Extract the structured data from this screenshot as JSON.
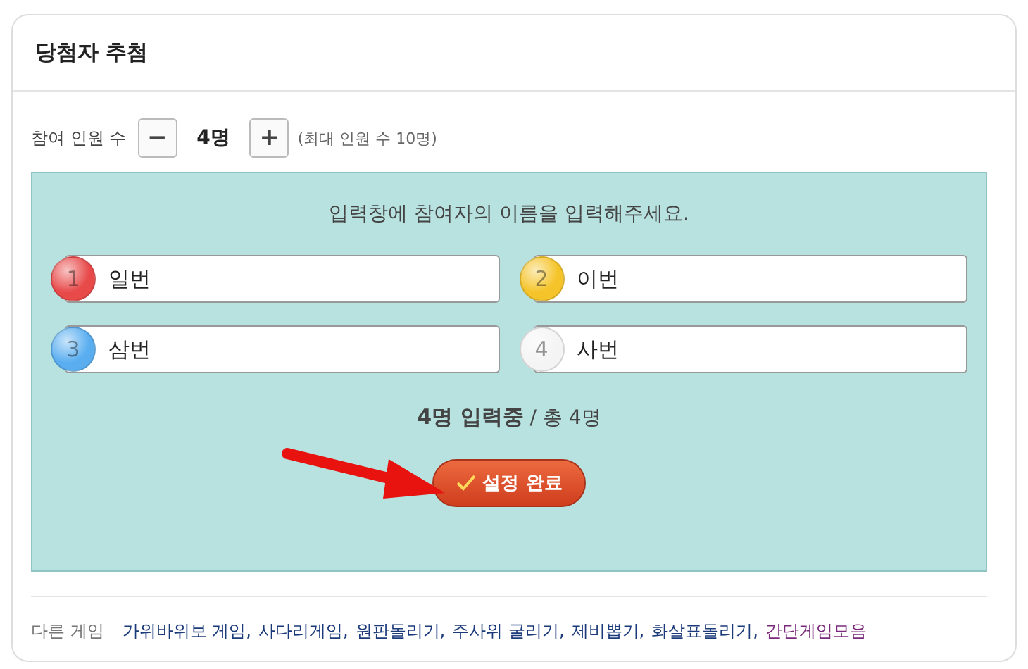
{
  "header": {
    "title": "당첨자 추첨"
  },
  "counter": {
    "label": "참여 인원 수",
    "minus": "−",
    "value": "4명",
    "plus": "+",
    "note": "(최대 인원 수 10명)"
  },
  "panel": {
    "instruction": "입력창에 참여자의 이름을 입력해주세요.",
    "entries": [
      {
        "number": "1",
        "value": "일번",
        "color": "#e84a4a"
      },
      {
        "number": "2",
        "value": "이번",
        "color": "#f5c42a"
      },
      {
        "number": "3",
        "value": "삼번",
        "color": "#5aaef0"
      },
      {
        "number": "4",
        "value": "사번",
        "color": "#f4f4f4"
      }
    ],
    "status_bold": "4명 입력중",
    "status_rest": "/ 총 4명",
    "button": "설정 완료"
  },
  "footer": {
    "label": "다른 게임",
    "links": [
      {
        "text": "가위바위보 게임,",
        "visited": false
      },
      {
        "text": "사다리게임,",
        "visited": false
      },
      {
        "text": "원판돌리기,",
        "visited": false
      },
      {
        "text": "주사위 굴리기,",
        "visited": false
      },
      {
        "text": "제비뽑기,",
        "visited": false
      },
      {
        "text": "화살표돌리기,",
        "visited": false
      },
      {
        "text": "간단게임모음",
        "visited": true
      }
    ]
  }
}
